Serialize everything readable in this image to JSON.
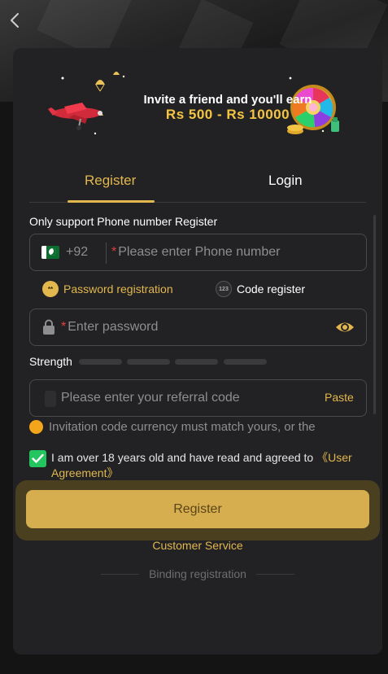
{
  "banner": {
    "line1": "Invite a friend and you'll earn",
    "line2": "Rs 500 - Rs 10000"
  },
  "tabs": [
    {
      "label": "Register",
      "active": true
    },
    {
      "label": "Login",
      "active": false
    }
  ],
  "form": {
    "phone_note": "Only support Phone number Register",
    "country_code": "+92",
    "phone_placeholder": "Please enter Phone number",
    "required_mark": "*",
    "options": {
      "password_label": "Password registration",
      "password_icon_text": "**",
      "code_label": "Code register",
      "code_icon_text": "123"
    },
    "password_placeholder": "Enter password",
    "strength_label": "Strength",
    "referral_placeholder": "Please enter your referral code",
    "paste_label": "Paste",
    "invite_note": "Invitation code currency must match yours, or the",
    "agree_text": "I am over 18 years old and have read and agreed to ",
    "agree_link": "《User Agreement》",
    "agree_checked": true,
    "register_button": "Register"
  },
  "footer": {
    "customer_service": "Customer Service",
    "binding_registration": "Binding registration"
  },
  "colors": {
    "accent": "#e2b74d",
    "background": "#141414",
    "card": "#222224",
    "checkbox": "#22c55e",
    "invite_dot": "#f3a51c"
  },
  "icons": {
    "back": "chevron-left-icon",
    "flag": "pakistan-flag-icon",
    "lock": "lock-icon",
    "eye": "eye-icon",
    "check": "check-icon",
    "info": "info-dot-icon"
  }
}
